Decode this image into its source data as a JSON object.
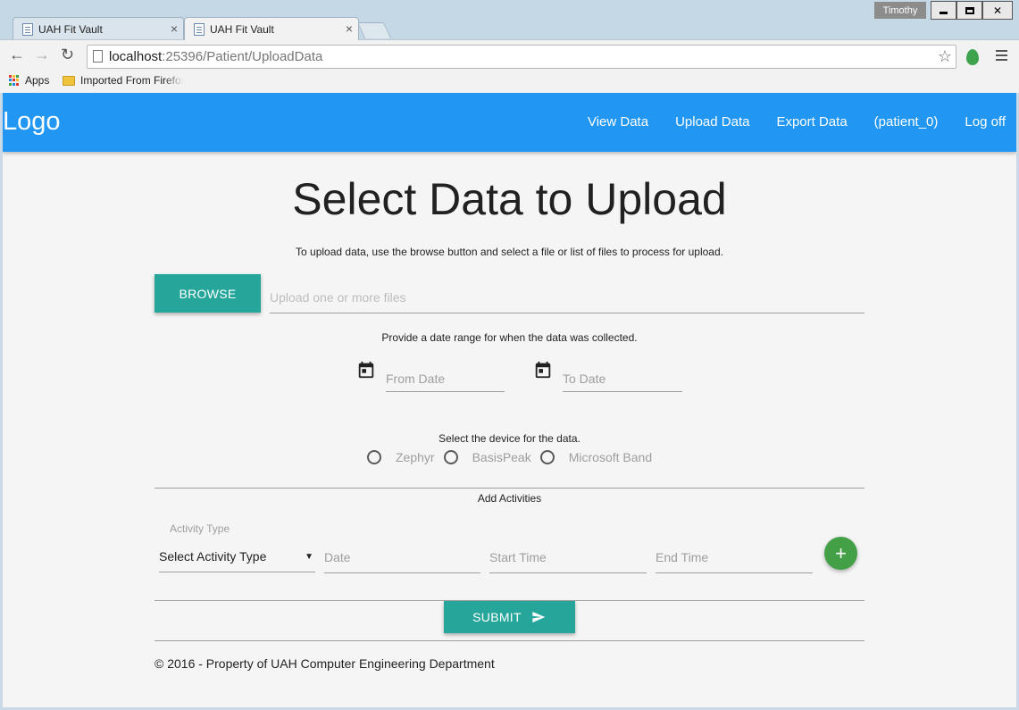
{
  "browser": {
    "tabs": [
      {
        "title": "UAH Fit Vault",
        "active": false
      },
      {
        "title": "UAH Fit Vault",
        "active": true
      }
    ],
    "user": "Timothy",
    "url_host": "localhost",
    "url_path": ":25396/Patient/UploadData",
    "bookmarks": {
      "apps": "Apps",
      "folder": "Imported From Firefox"
    },
    "tab_close_glyph": "×",
    "window_close_glyph": "✕",
    "star_glyph": "☆",
    "back_glyph": "←",
    "forward_glyph": "→",
    "reload_glyph": "↻"
  },
  "navbar": {
    "logo": "Logo",
    "links": [
      "View Data",
      "Upload Data",
      "Export Data",
      "(patient_0)",
      "Log off"
    ],
    "color": "#2196f3"
  },
  "main": {
    "title": "Select Data to Upload",
    "upload_instruction": "To upload data, use the browse button and select a file or list of files to process for upload.",
    "browse_label": "BROWSE",
    "file_placeholder": "Upload one or more files",
    "date_instruction": "Provide a date range for when the data was collected.",
    "from_date_placeholder": "From Date",
    "to_date_placeholder": "To Date",
    "device_instruction": "Select the device for the data.",
    "devices": [
      "Zephyr",
      "BasisPeak",
      "Microsoft Band"
    ],
    "activities_title": "Add Activities",
    "activity_type_label": "Activity Type",
    "activity_type_value": "Select Activity Type",
    "caret_glyph": "▼",
    "date_placeholder": "Date",
    "start_time_placeholder": "Start Time",
    "end_time_placeholder": "End Time",
    "add_glyph": "+",
    "submit_label": "SUBMIT",
    "accent_color": "#26a69a",
    "add_color": "#43a047"
  },
  "footer": {
    "text": "© 2016 - Property of UAH Computer Engineering Department"
  }
}
